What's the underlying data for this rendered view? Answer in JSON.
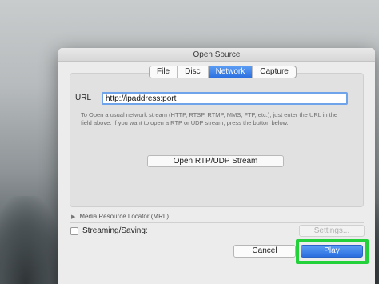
{
  "window": {
    "title": "Open Source"
  },
  "tabs": [
    {
      "label": "File",
      "active": false
    },
    {
      "label": "Disc",
      "active": false
    },
    {
      "label": "Network",
      "active": true
    },
    {
      "label": "Capture",
      "active": false
    }
  ],
  "network": {
    "url_label": "URL",
    "url_value": "http://ipaddress:port",
    "help_text": "To Open a usual network stream (HTTP, RTSP, RTMP, MMS, FTP, etc.), just enter the URL in the field above. If you want to open a RTP or UDP stream, press the button below.",
    "rtp_button": "Open RTP/UDP Stream"
  },
  "mrl": {
    "label": "Media Resource Locator (MRL)",
    "expanded": false
  },
  "streaming": {
    "label": "Streaming/Saving:",
    "checked": false,
    "settings_button": "Settings..."
  },
  "actions": {
    "cancel": "Cancel",
    "play": "Play"
  },
  "colors": {
    "accent": "#2c70e0",
    "highlight": "#23d23a"
  }
}
